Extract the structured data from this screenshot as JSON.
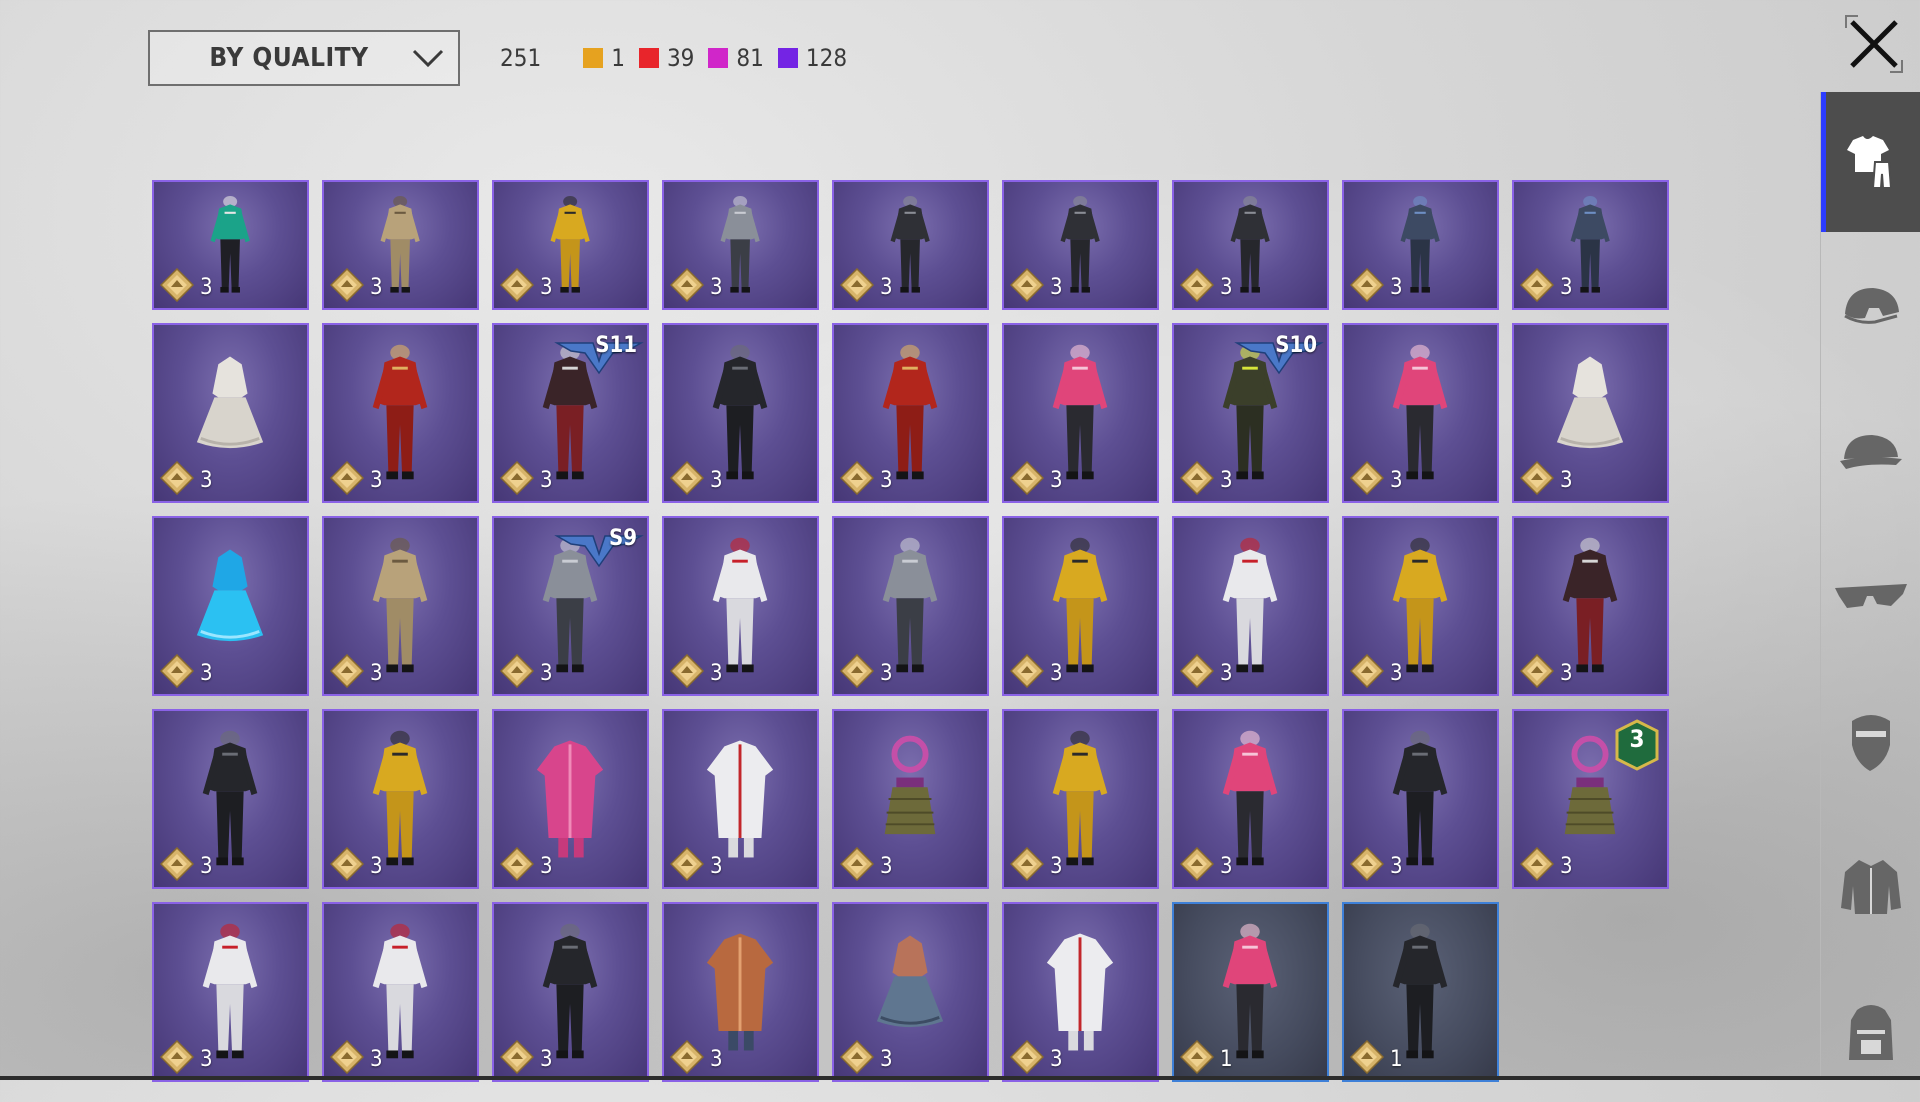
{
  "sort": {
    "label": "BY QUALITY"
  },
  "counts": {
    "total": "251",
    "items": [
      {
        "color": "#e6a21f",
        "value": "1"
      },
      {
        "color": "#e8252b",
        "value": "39"
      },
      {
        "color": "#d026c9",
        "value": "81"
      },
      {
        "color": "#7424e4",
        "value": "128"
      }
    ]
  },
  "close": {
    "icon": "close-icon"
  },
  "inventory": [
    {
      "qty": "3",
      "outfit": "suit-teal"
    },
    {
      "qty": "3",
      "outfit": "suit-tan"
    },
    {
      "qty": "3",
      "outfit": "suit-yellow"
    },
    {
      "qty": "3",
      "outfit": "suit-grey"
    },
    {
      "qty": "3",
      "outfit": "suit-dark"
    },
    {
      "qty": "3",
      "outfit": "suit-dark"
    },
    {
      "qty": "3",
      "outfit": "suit-dark"
    },
    {
      "qty": "3",
      "outfit": "suit-blue"
    },
    {
      "qty": "3",
      "outfit": "suit-blue"
    },
    {
      "qty": "3",
      "outfit": "dress-white"
    },
    {
      "qty": "3",
      "outfit": "suit-red"
    },
    {
      "qty": "3",
      "outfit": "suit-darkred",
      "season": "S11"
    },
    {
      "qty": "3",
      "outfit": "suit-black"
    },
    {
      "qty": "3",
      "outfit": "suit-red"
    },
    {
      "qty": "3",
      "outfit": "suit-pink"
    },
    {
      "qty": "3",
      "outfit": "suit-lime",
      "season": "S10"
    },
    {
      "qty": "3",
      "outfit": "suit-pink"
    },
    {
      "qty": "3",
      "outfit": "dress-white"
    },
    {
      "qty": "3",
      "outfit": "dress-cyan"
    },
    {
      "qty": "3",
      "outfit": "suit-tan"
    },
    {
      "qty": "3",
      "outfit": "suit-grey",
      "season": "S9"
    },
    {
      "qty": "3",
      "outfit": "suit-white"
    },
    {
      "qty": "3",
      "outfit": "suit-grey"
    },
    {
      "qty": "3",
      "outfit": "suit-yellow"
    },
    {
      "qty": "3",
      "outfit": "suit-white"
    },
    {
      "qty": "3",
      "outfit": "suit-yellow"
    },
    {
      "qty": "3",
      "outfit": "suit-darkred"
    },
    {
      "qty": "3",
      "outfit": "suit-black"
    },
    {
      "qty": "3",
      "outfit": "suit-yellow"
    },
    {
      "qty": "3",
      "outfit": "coat-pink"
    },
    {
      "qty": "3",
      "outfit": "coat-white"
    },
    {
      "qty": "3",
      "outfit": "skirt-grass"
    },
    {
      "qty": "3",
      "outfit": "suit-yellow"
    },
    {
      "qty": "3",
      "outfit": "suit-pink"
    },
    {
      "qty": "3",
      "outfit": "suit-black"
    },
    {
      "qty": "3",
      "outfit": "skirt-grass",
      "level": "3"
    },
    {
      "qty": "3",
      "outfit": "suit-white"
    },
    {
      "qty": "3",
      "outfit": "suit-white"
    },
    {
      "qty": "3",
      "outfit": "suit-black"
    },
    {
      "qty": "3",
      "outfit": "coat-orange"
    },
    {
      "qty": "3",
      "outfit": "dress-blue"
    },
    {
      "qty": "3",
      "outfit": "coat-white"
    },
    {
      "qty": "1",
      "outfit": "suit-pink",
      "tier": "dark"
    },
    {
      "qty": "1",
      "outfit": "suit-black",
      "tier": "dark"
    }
  ],
  "sidebar": [
    {
      "name": "tab-outfits",
      "icon": "outfit-icon",
      "active": true
    },
    {
      "name": "tab-helmet",
      "icon": "helmet-icon"
    },
    {
      "name": "tab-hat",
      "icon": "cap-icon"
    },
    {
      "name": "tab-glasses",
      "icon": "glasses-icon"
    },
    {
      "name": "tab-mask",
      "icon": "mask-icon"
    },
    {
      "name": "tab-jacket",
      "icon": "jacket-icon"
    },
    {
      "name": "tab-backpack",
      "icon": "backpack-icon"
    }
  ],
  "colors": {
    "legendary_border": "#8a62e6",
    "epic_border": "#3e80d8",
    "active_tab_accent": "#2c3cff"
  }
}
